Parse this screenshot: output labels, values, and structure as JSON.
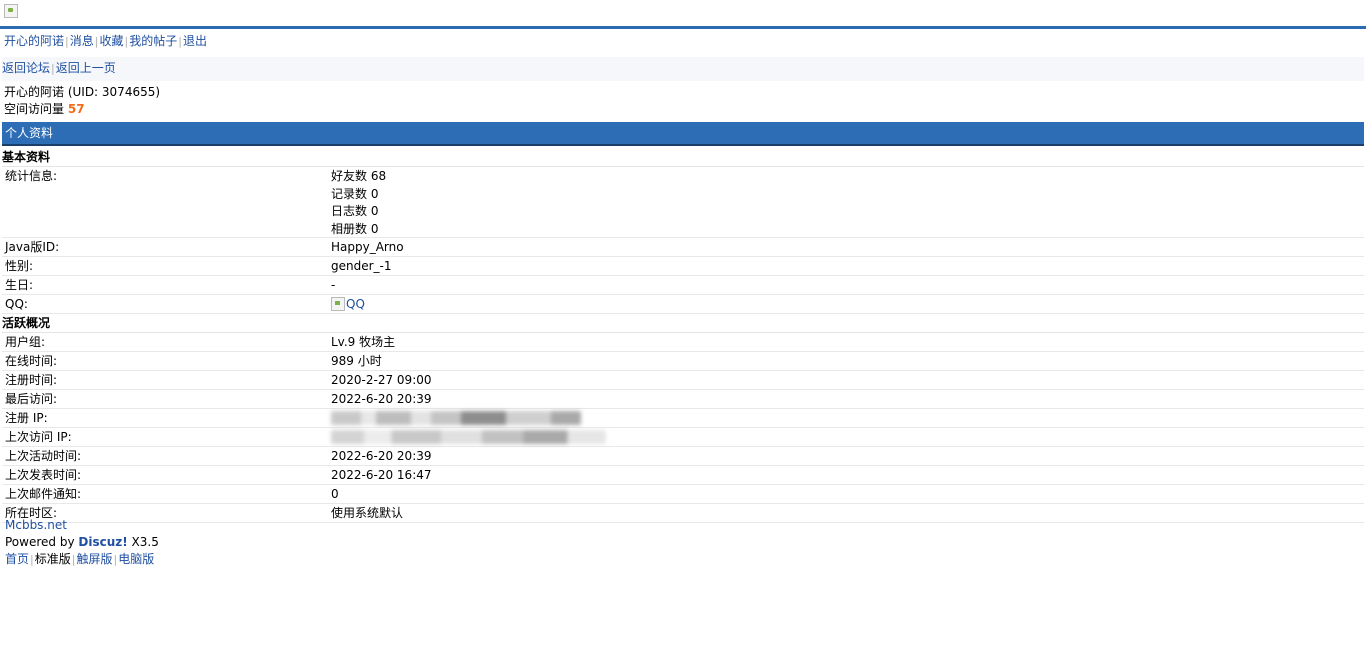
{
  "nav": {
    "username_link": "开心的阿诺",
    "items": [
      "消息",
      "收藏",
      "我的帖子",
      "退出"
    ]
  },
  "subnav": {
    "back_forum": "返回论坛",
    "back_prev": "返回上一页"
  },
  "profile": {
    "name_uid": "开心的阿诺 (UID: 3074655)",
    "visits_label": "空间访问量",
    "visits_value": "57"
  },
  "section_title": "个人资料",
  "basic": {
    "group_title": "基本资料",
    "stats_label": "统计信息:",
    "stats": [
      "好友数 68",
      "记录数 0",
      "日志数 0",
      "相册数 0"
    ],
    "rows": [
      {
        "label": "Java版ID:",
        "value": "Happy_Arno"
      },
      {
        "label": "性别:",
        "value": "gender_-1"
      },
      {
        "label": "生日:",
        "value": "-"
      }
    ],
    "qq_label": "QQ:",
    "qq_alt": "QQ"
  },
  "activity": {
    "group_title": "活跃概况",
    "rows_top": [
      {
        "label": "用户组:",
        "value": "Lv.9 牧场主"
      },
      {
        "label": "在线时间:",
        "value": "989 小时"
      },
      {
        "label": "注册时间:",
        "value": "2020-2-27 09:00"
      },
      {
        "label": "最后访问:",
        "value": "2022-6-20 20:39"
      }
    ],
    "reg_ip_label": "注册 IP:",
    "last_ip_label": "上次访问 IP:",
    "rows_bottom": [
      {
        "label": "上次活动时间:",
        "value": "2022-6-20 20:39"
      },
      {
        "label": "上次发表时间:",
        "value": "2022-6-20 16:47"
      },
      {
        "label": "上次邮件通知:",
        "value": "0"
      },
      {
        "label": "所在时区:",
        "value": "使用系统默认"
      }
    ]
  },
  "footer": {
    "site": "Mcbbs.net",
    "powered_prefix": "Powered by ",
    "powered_brand": "Discuz!",
    "powered_version": " X3.5",
    "links": [
      "首页",
      "标准版",
      "触屏版",
      "电脑版"
    ]
  },
  "colors": {
    "accent": "#2c6db5",
    "link": "#2050a0",
    "visits": "#f26c1a"
  }
}
